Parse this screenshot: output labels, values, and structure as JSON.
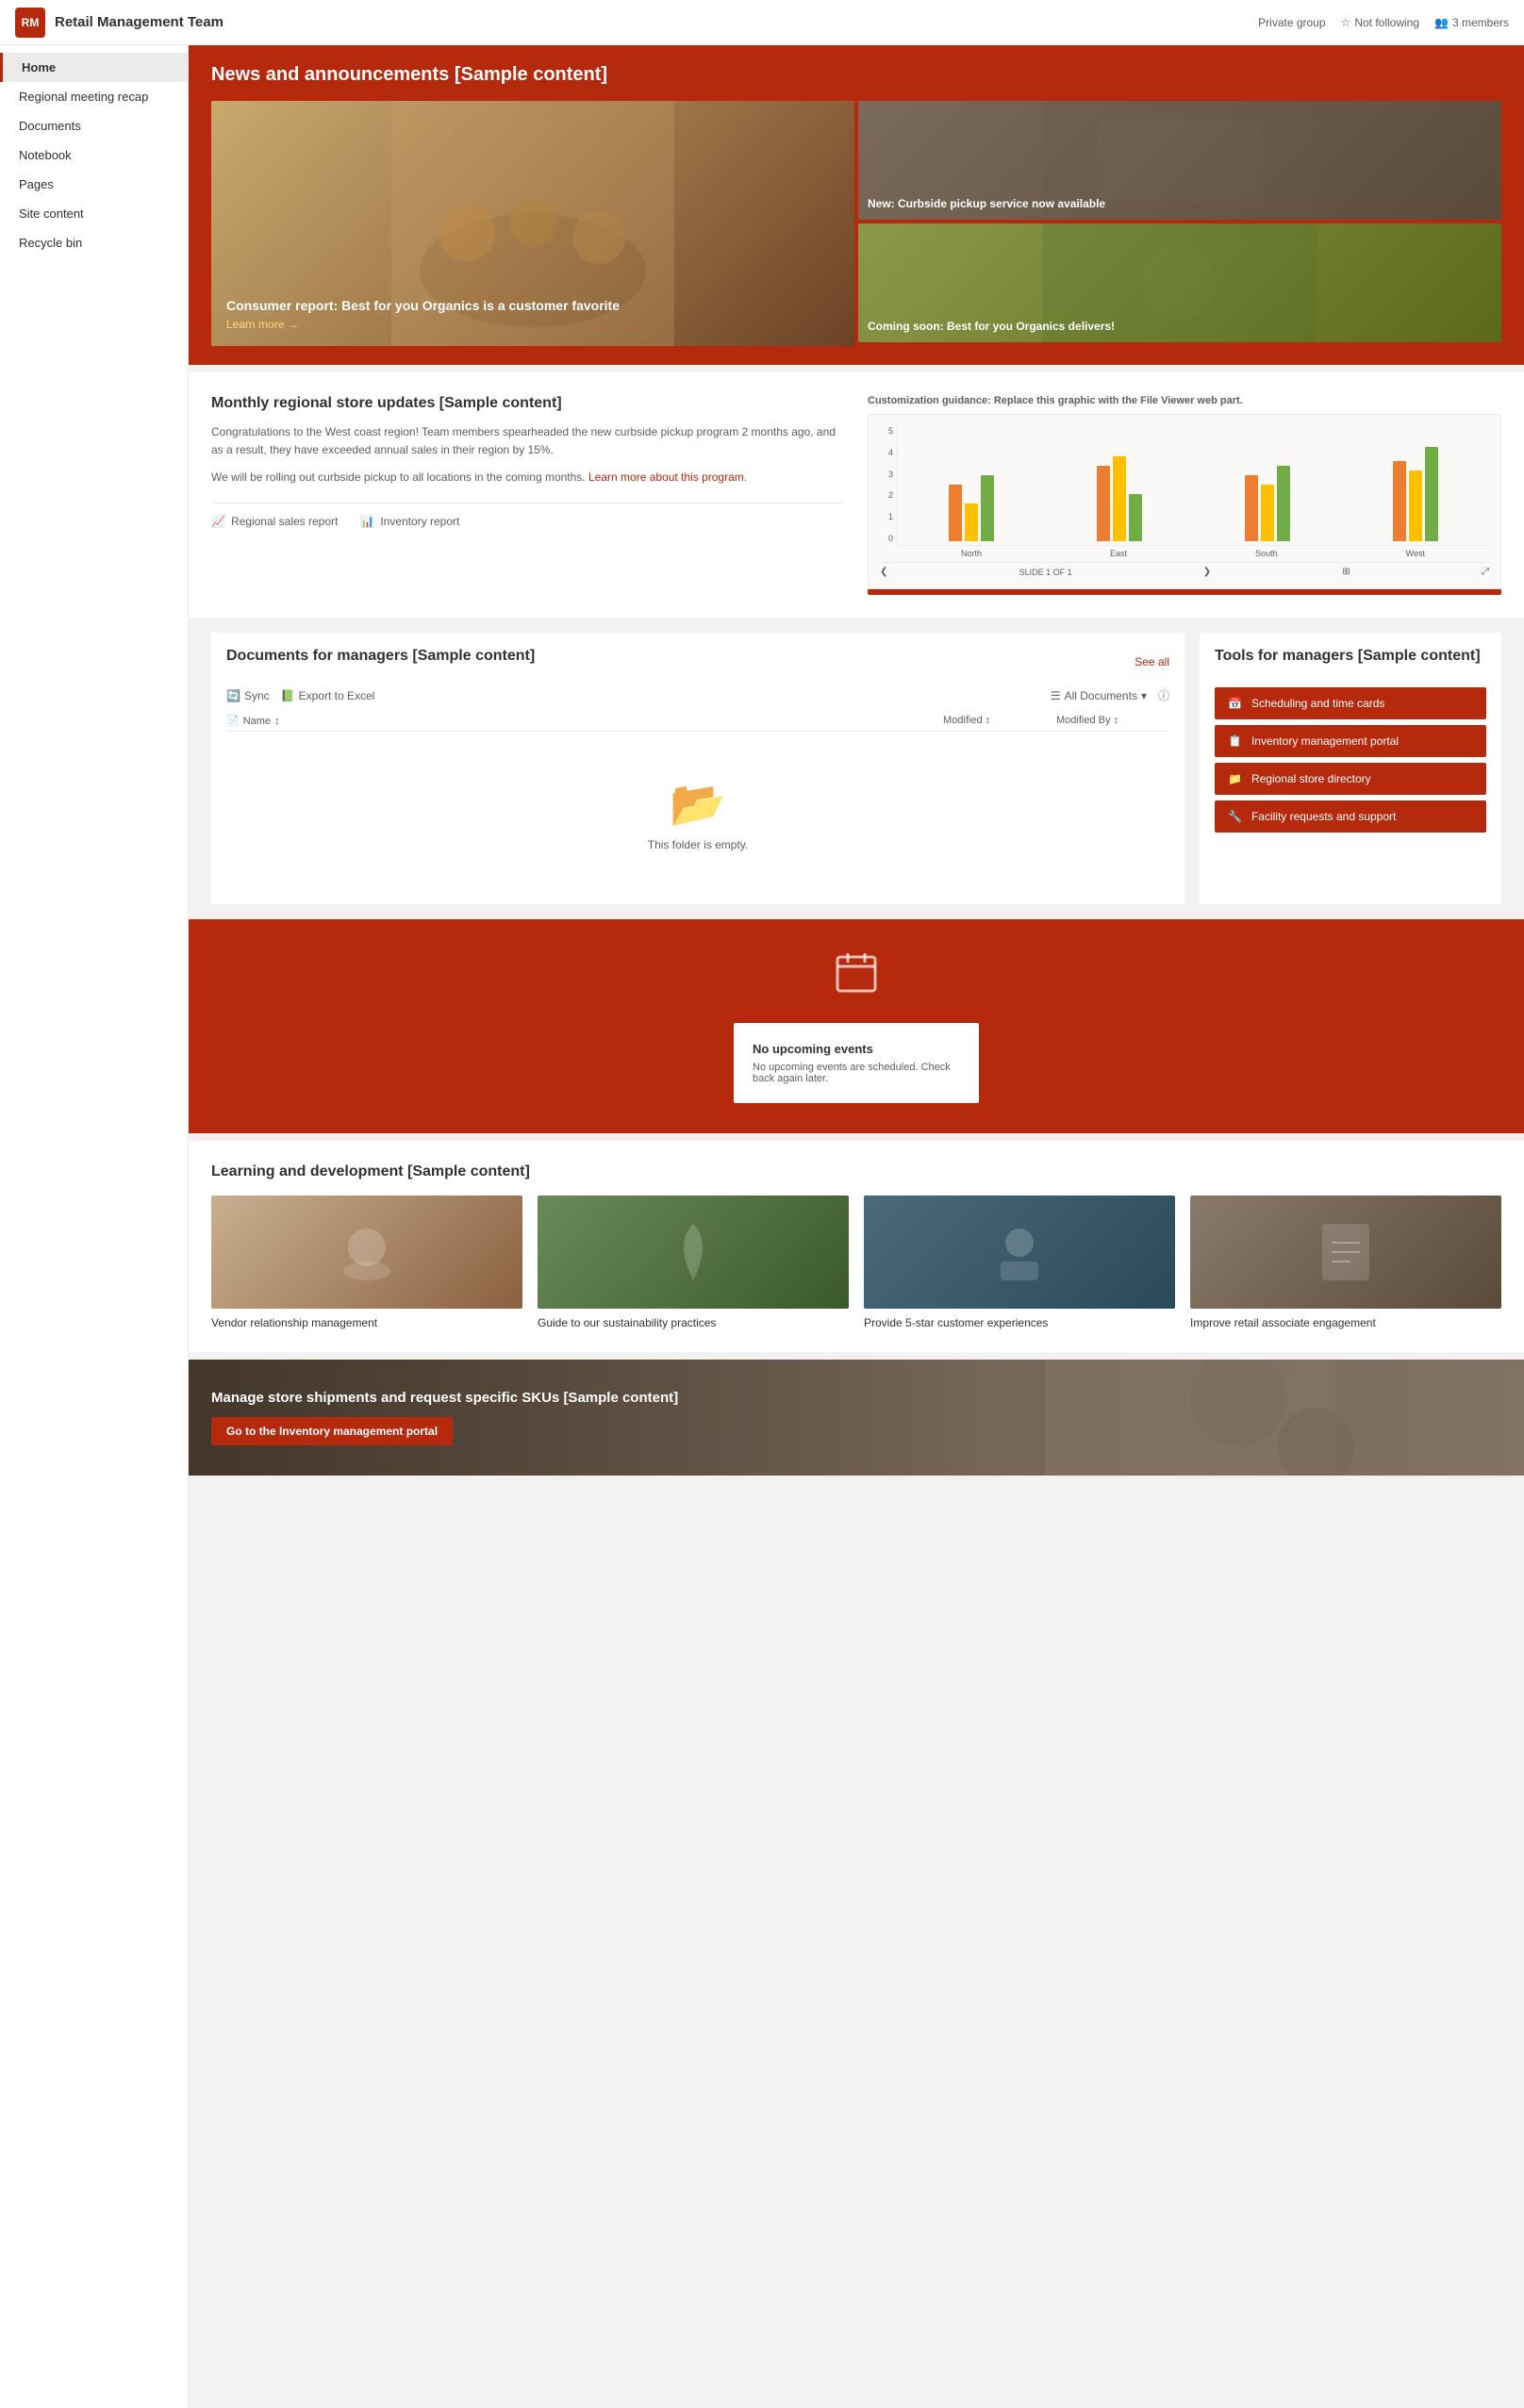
{
  "site": {
    "icon": "RM",
    "title": "Retail Management Team",
    "visibility": "Private group",
    "follow_label": "Not following",
    "members_label": "3 members"
  },
  "sidebar": {
    "items": [
      {
        "id": "home",
        "label": "Home",
        "active": true
      },
      {
        "id": "regional-meeting-recap",
        "label": "Regional meeting recap",
        "active": false
      },
      {
        "id": "documents",
        "label": "Documents",
        "active": false
      },
      {
        "id": "notebook",
        "label": "Notebook",
        "active": false
      },
      {
        "id": "pages",
        "label": "Pages",
        "active": false
      },
      {
        "id": "site-content",
        "label": "Site content",
        "active": false
      },
      {
        "id": "recycle-bin",
        "label": "Recycle bin",
        "active": false
      }
    ]
  },
  "hero": {
    "title": "News and announcements [Sample content]",
    "main_headline": "Consumer report: Best for you Organics is a customer favorite",
    "learn_more": "Learn more →",
    "top_right_caption": "New: Curbside pickup service now available",
    "bottom_right_caption": "Coming soon: Best for you Organics delivers!"
  },
  "monthly": {
    "title": "Monthly regional store updates [Sample content]",
    "customization_note": "Customization guidance:",
    "customization_text": "Replace this graphic with the File Viewer web part.",
    "paragraph1": "Congratulations to the West coast region! Team members spearheaded the new curbside pickup program 2 months ago, and as a result, they have exceeded annual sales in their region by 15%.",
    "paragraph2": "We will be rolling out curbside pickup to all locations in the coming months.",
    "learn_more_link": "Learn more about this program.",
    "report1_label": "Regional sales report",
    "report2_label": "Inventory report",
    "chart": {
      "slide_label": "SLIDE 1 OF 1",
      "groups": [
        {
          "label": "North",
          "bars": [
            {
              "height": 60,
              "color": "#ed7d31"
            },
            {
              "height": 40,
              "color": "#ffc000"
            },
            {
              "height": 70,
              "color": "#70ad47"
            }
          ]
        },
        {
          "label": "East",
          "bars": [
            {
              "height": 80,
              "color": "#ed7d31"
            },
            {
              "height": 90,
              "color": "#ffc000"
            },
            {
              "height": 50,
              "color": "#70ad47"
            }
          ]
        },
        {
          "label": "South",
          "bars": [
            {
              "height": 70,
              "color": "#ed7d31"
            },
            {
              "height": 60,
              "color": "#ffc000"
            },
            {
              "height": 80,
              "color": "#70ad47"
            }
          ]
        },
        {
          "label": "West",
          "bars": [
            {
              "height": 85,
              "color": "#ed7d31"
            },
            {
              "height": 75,
              "color": "#ffc000"
            },
            {
              "height": 100,
              "color": "#70ad47"
            }
          ]
        }
      ],
      "y_labels": [
        "5",
        "4",
        "3",
        "2",
        "1",
        "0"
      ]
    }
  },
  "documents": {
    "title": "Documents for managers [Sample content]",
    "see_all_label": "See all",
    "sync_label": "Sync",
    "export_label": "Export to Excel",
    "all_docs_label": "All Documents",
    "col_name": "Name",
    "col_modified": "Modified",
    "col_modified_by": "Modified By",
    "empty_text": "This folder is empty."
  },
  "tools": {
    "title": "Tools for managers [Sample content]",
    "items": [
      {
        "id": "scheduling",
        "label": "Scheduling and time cards",
        "icon": "📅"
      },
      {
        "id": "inventory",
        "label": "Inventory management portal",
        "icon": "📋"
      },
      {
        "id": "regional-store",
        "label": "Regional store directory",
        "icon": "📁"
      },
      {
        "id": "facility",
        "label": "Facility requests and support",
        "icon": "🔧"
      }
    ]
  },
  "events": {
    "no_events_title": "No upcoming events",
    "no_events_text": "No upcoming events are scheduled. Check back again later."
  },
  "learning": {
    "title": "Learning and development [Sample content]",
    "cards": [
      {
        "id": "vendor",
        "title": "Vendor relationship management"
      },
      {
        "id": "sustainability",
        "title": "Guide to our sustainability practices"
      },
      {
        "id": "customer",
        "title": "Provide 5-star customer experiences"
      },
      {
        "id": "engagement",
        "title": "Improve retail associate engagement"
      }
    ]
  },
  "footer_cta": {
    "title": "Manage store shipments and request specific SKUs [Sample content]",
    "button_label": "Go to the Inventory management portal"
  }
}
